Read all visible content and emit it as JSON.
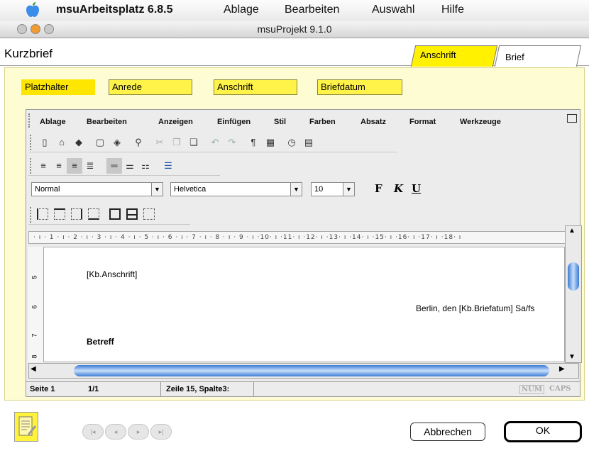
{
  "menubar": {
    "app_name": "msuArbeitsplatz 6.8.5",
    "items": [
      "Ablage",
      "Bearbeiten",
      "Auswahl",
      "Hilfe"
    ]
  },
  "window": {
    "title": "msuProjekt 9.1.0"
  },
  "header": {
    "title": "Kurzbrief",
    "tabs": [
      {
        "label": "Anschrift",
        "active": true
      },
      {
        "label": "Brief",
        "active": false
      }
    ]
  },
  "placeholders": [
    "Platzhalter",
    "Anrede",
    "Anschrift",
    "Briefdatum"
  ],
  "editor": {
    "menu": [
      "Ablage",
      "Bearbeiten",
      "Anzeigen",
      "Einfügen",
      "Stil",
      "Farben",
      "Absatz",
      "Format",
      "Werkzeuge"
    ],
    "style_select": "Normal",
    "font_select": "Helvetica",
    "size_select": "10",
    "format_buttons": [
      "F",
      "K",
      "U"
    ],
    "ruler": "· ı · 1 · ı · 2 · ı · 3 · ı · 4 · ı · 5 · ı · 6 · ı · 7 · ı · 8 · ı · 9 · ı ·10· ı ·11· ı ·12· ı ·13· ı ·14· ı ·15· ı ·16· ı ·17· ı ·18· ı",
    "vruler_marks": [
      "5",
      "6",
      "7",
      "8"
    ]
  },
  "document": {
    "anschrift": "[Kb.Anschrift]",
    "datum": "Berlin, den [Kb.Briefatum] Sa/fs",
    "betreff": "Betreff"
  },
  "statusbar": {
    "page": "Seite 1",
    "pages": "1/1",
    "position": "Zeile 15, Spalte3:",
    "num": "NUM",
    "caps": "CAPS"
  },
  "footer": {
    "cancel": "Abbrechen",
    "ok": "OK",
    "nav": [
      "|◂",
      "◂",
      "▸",
      "▸|"
    ]
  },
  "colors": {
    "tab_active": "#fff100",
    "panel": "#fdfcd2",
    "scroll_blue": "#3a7bd5"
  }
}
